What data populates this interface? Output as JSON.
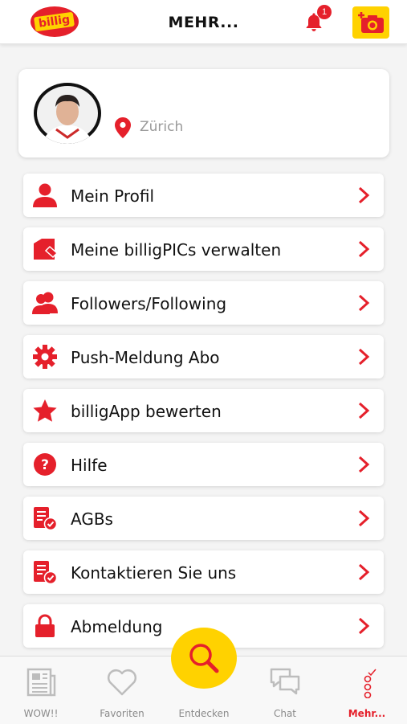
{
  "header": {
    "logo_text": "billig",
    "title": "MEHR...",
    "notification_count": "1"
  },
  "profile": {
    "location": "Zürich"
  },
  "menu": [
    {
      "label": "Mein Profil",
      "icon": "user-icon"
    },
    {
      "label": "Meine billigPICs verwalten",
      "icon": "pics-icon"
    },
    {
      "label": "Followers/Following",
      "icon": "followers-icon"
    },
    {
      "label": "Push-Meldung Abo",
      "icon": "gear-icon"
    },
    {
      "label": "billigApp bewerten",
      "icon": "star-icon"
    },
    {
      "label": "Hilfe",
      "icon": "help-icon"
    },
    {
      "label": "AGBs",
      "icon": "document-check-icon"
    },
    {
      "label": "Kontaktieren Sie uns",
      "icon": "document-check-icon"
    },
    {
      "label": "Abmeldung",
      "icon": "lock-icon"
    }
  ],
  "nav": {
    "wow": "WOW!!",
    "favoriten": "Favoriten",
    "entdecken": "Entdecken",
    "chat": "Chat",
    "mehr": "Mehr..."
  },
  "colors": {
    "accent": "#e5202b",
    "yellow": "#ffd200"
  }
}
